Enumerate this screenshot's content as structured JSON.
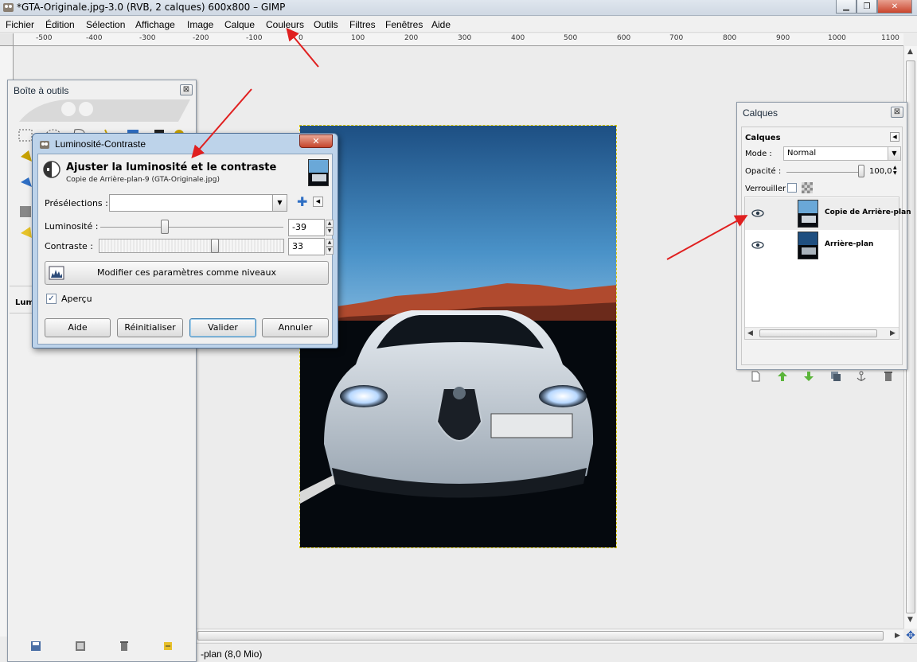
{
  "window": {
    "title": "*GTA-Originale.jpg-3.0 (RVB, 2 calques) 600x800 – GIMP",
    "minimize": "▁",
    "maximize": "❐",
    "close": "✕"
  },
  "menu": [
    "Fichier",
    "Édition",
    "Sélection",
    "Affichage",
    "Image",
    "Calque",
    "Couleurs",
    "Outils",
    "Filtres",
    "Fenêtres",
    "Aide"
  ],
  "ruler": {
    "labels": [
      "-500",
      "-400",
      "-300",
      "-200",
      "-100",
      "0",
      "100",
      "200",
      "300",
      "400",
      "500",
      "600",
      "700",
      "800",
      "900",
      "1000",
      "1100"
    ]
  },
  "statusbar": {
    "text": "-plan (8,0 Mio)"
  },
  "toolbox": {
    "title": "Boîte à outils",
    "close": "⊠",
    "tab_label": "Lumi"
  },
  "layers": {
    "title": "Calques",
    "close": "⊠",
    "tab_label": "Calques",
    "mode_label": "Mode :",
    "mode_value": "Normal",
    "opacity_label": "Opacité :",
    "opacity_value": "100,0",
    "lock_label": "Verrouiller :",
    "items": [
      {
        "name": "Copie de Arrière-plan"
      },
      {
        "name": "Arrière-plan"
      }
    ]
  },
  "dialog": {
    "title": "Luminosité-Contraste",
    "close": "✕",
    "heading": "Ajuster la luminosité et le contraste",
    "subtitle": "Copie de Arrière-plan-9 (GTA-Originale.jpg)",
    "presets_label": "Présélections :",
    "presets_value": "",
    "brightness_label": "Luminosité :",
    "brightness_value": "-39",
    "contrast_label": "Contraste :",
    "contrast_value": "33",
    "levels_button": "Modifier ces paramètres comme niveaux",
    "preview_label": "Aperçu",
    "preview_checked": "✓",
    "buttons": {
      "help": "Aide",
      "reset": "Réinitialiser",
      "ok": "Valider",
      "cancel": "Annuler"
    }
  },
  "colors": {
    "accent": "#2f6fc4",
    "dialog_frame": "#bdd3ea",
    "annotation_arrow": "#e02020"
  }
}
